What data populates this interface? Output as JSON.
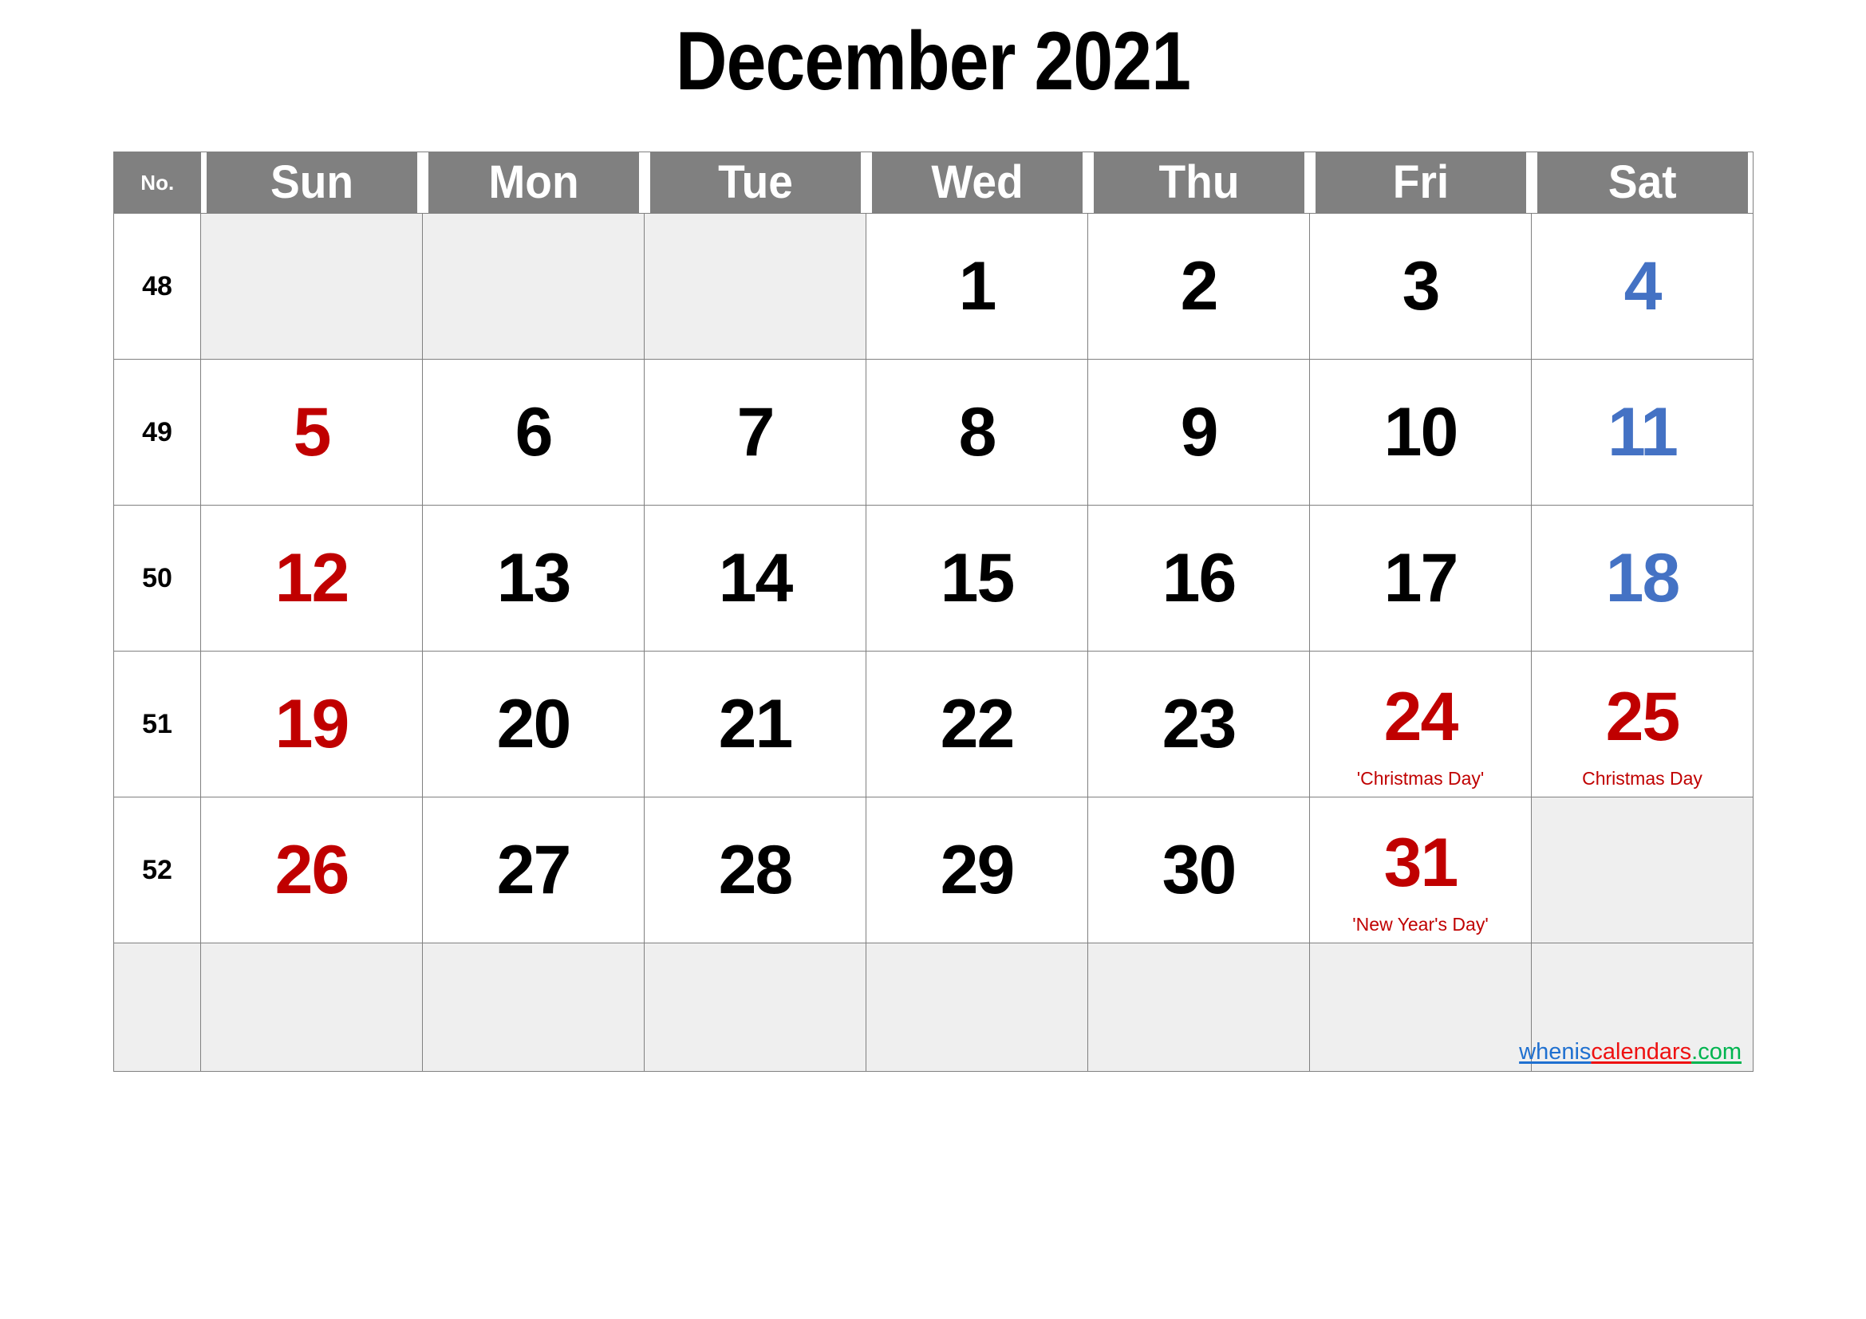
{
  "title": "December 2021",
  "month": "December",
  "year": "2021",
  "header": {
    "week_no_label": "No.",
    "days": [
      "Sun",
      "Mon",
      "Tue",
      "Wed",
      "Thu",
      "Fri",
      "Sat"
    ]
  },
  "colors": {
    "header_bg": "#808080",
    "header_text": "#ffffff",
    "grid_line": "#808080",
    "empty_cell_bg": "#efefef",
    "weekday_text": "#000000",
    "sunday_text": "#C00000",
    "saturday_text": "#4472C4",
    "holiday_text": "#C00000",
    "watermark_blue": "#1F70D0",
    "watermark_red": "#EE1111",
    "watermark_green": "#00B44F"
  },
  "weeks": [
    {
      "no": "48",
      "days": [
        {
          "num": "",
          "kind": "empty",
          "note": ""
        },
        {
          "num": "",
          "kind": "empty",
          "note": ""
        },
        {
          "num": "",
          "kind": "empty",
          "note": ""
        },
        {
          "num": "1",
          "kind": "weekday",
          "note": ""
        },
        {
          "num": "2",
          "kind": "weekday",
          "note": ""
        },
        {
          "num": "3",
          "kind": "weekday",
          "note": ""
        },
        {
          "num": "4",
          "kind": "sat",
          "note": ""
        }
      ]
    },
    {
      "no": "49",
      "days": [
        {
          "num": "5",
          "kind": "sun",
          "note": ""
        },
        {
          "num": "6",
          "kind": "weekday",
          "note": ""
        },
        {
          "num": "7",
          "kind": "weekday",
          "note": ""
        },
        {
          "num": "8",
          "kind": "weekday",
          "note": ""
        },
        {
          "num": "9",
          "kind": "weekday",
          "note": ""
        },
        {
          "num": "10",
          "kind": "weekday",
          "note": ""
        },
        {
          "num": "11",
          "kind": "sat",
          "note": ""
        }
      ]
    },
    {
      "no": "50",
      "days": [
        {
          "num": "12",
          "kind": "sun",
          "note": ""
        },
        {
          "num": "13",
          "kind": "weekday",
          "note": ""
        },
        {
          "num": "14",
          "kind": "weekday",
          "note": ""
        },
        {
          "num": "15",
          "kind": "weekday",
          "note": ""
        },
        {
          "num": "16",
          "kind": "weekday",
          "note": ""
        },
        {
          "num": "17",
          "kind": "weekday",
          "note": ""
        },
        {
          "num": "18",
          "kind": "sat",
          "note": ""
        }
      ]
    },
    {
      "no": "51",
      "days": [
        {
          "num": "19",
          "kind": "sun",
          "note": ""
        },
        {
          "num": "20",
          "kind": "weekday",
          "note": ""
        },
        {
          "num": "21",
          "kind": "weekday",
          "note": ""
        },
        {
          "num": "22",
          "kind": "weekday",
          "note": ""
        },
        {
          "num": "23",
          "kind": "weekday",
          "note": ""
        },
        {
          "num": "24",
          "kind": "holiday",
          "note": "'Christmas Day'"
        },
        {
          "num": "25",
          "kind": "holiday",
          "note": "Christmas Day"
        }
      ]
    },
    {
      "no": "52",
      "days": [
        {
          "num": "26",
          "kind": "sun",
          "note": ""
        },
        {
          "num": "27",
          "kind": "weekday",
          "note": ""
        },
        {
          "num": "28",
          "kind": "weekday",
          "note": ""
        },
        {
          "num": "29",
          "kind": "weekday",
          "note": ""
        },
        {
          "num": "30",
          "kind": "weekday",
          "note": ""
        },
        {
          "num": "31",
          "kind": "holiday",
          "note": "'New Year's Day'"
        },
        {
          "num": "",
          "kind": "empty",
          "note": ""
        }
      ]
    }
  ],
  "footer": {
    "watermark": {
      "part1": "whenis",
      "part2": "calendars",
      "part3": ".com"
    }
  }
}
